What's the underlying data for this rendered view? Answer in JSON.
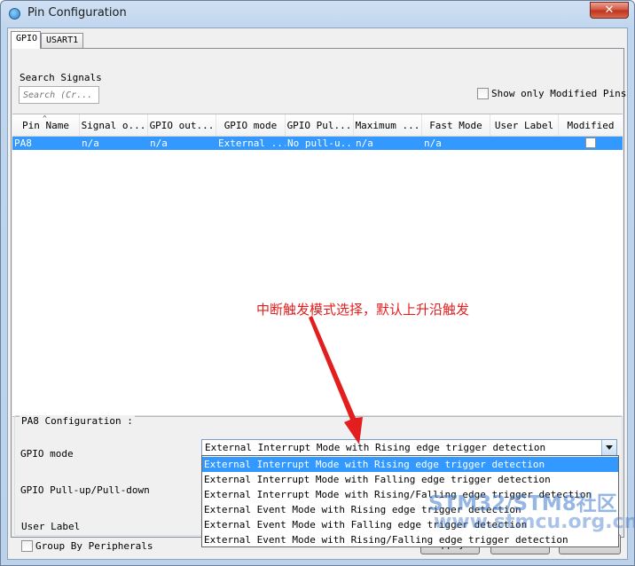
{
  "window": {
    "title": "Pin Configuration",
    "close_label": "✕"
  },
  "tabs": [
    {
      "label": "GPIO"
    },
    {
      "label": "USART1"
    }
  ],
  "search": {
    "label": "Search Signals",
    "placeholder": "Search (Cr..."
  },
  "filter": {
    "show_modified_label": "Show only Modified Pins",
    "checked": false
  },
  "table": {
    "columns": [
      "Pin Name",
      "Signal o...",
      "GPIO out...",
      "GPIO mode",
      "GPIO Pul...",
      "Maximum ...",
      "Fast Mode",
      "User Label",
      "Modified"
    ],
    "rows": [
      {
        "pin": "PA8",
        "signal": "n/a",
        "output": "n/a",
        "mode": "External ...",
        "pull": "No pull-u...",
        "maximum": "n/a",
        "fast": "n/a",
        "label": "",
        "modified": false
      }
    ]
  },
  "annotation": "中断触发模式选择，默认上升沿触发",
  "config": {
    "title": "PA8 Configuration :",
    "gpio_mode_label": "GPIO mode",
    "pull_label": "GPIO Pull-up/Pull-down",
    "user_label": "User Label",
    "gpio_mode_value": "External Interrupt Mode with Rising edge trigger detection",
    "options": [
      "External Interrupt Mode with Rising edge trigger detection",
      "External Interrupt Mode with Falling edge trigger detection",
      "External Interrupt Mode with Rising/Falling edge trigger detection",
      "External Event Mode with Rising edge trigger detection",
      "External Event Mode with Falling edge trigger detection",
      "External Event Mode with Rising/Falling edge trigger detection"
    ]
  },
  "footer": {
    "group_label": "Group By Peripherals",
    "apply": "Apply",
    "ok": "Ok",
    "cancel": "Cancel"
  },
  "watermark": {
    "line1": "STM32/STM8社区",
    "line2": "www.stmcu.org.cn"
  },
  "colors": {
    "selection": "#3399ff",
    "annotation": "#e21e1e"
  }
}
